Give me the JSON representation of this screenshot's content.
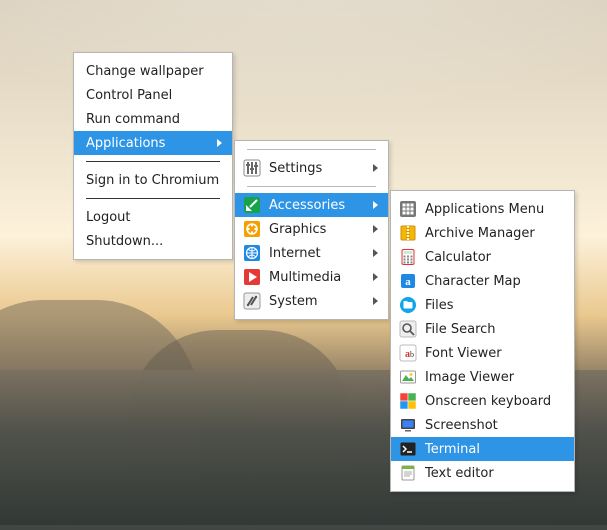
{
  "menu1": {
    "change_wallpaper": "Change wallpaper",
    "control_panel": "Control Panel",
    "run_command": "Run command",
    "applications": "Applications",
    "sign_in_chromium": "Sign in to Chromium",
    "logout": "Logout",
    "shutdown": "Shutdown..."
  },
  "menu2": {
    "settings": "Settings",
    "accessories": "Accessories",
    "graphics": "Graphics",
    "internet": "Internet",
    "multimedia": "Multimedia",
    "system": "System"
  },
  "menu3": {
    "applications_menu": "Applications Menu",
    "archive_manager": "Archive Manager",
    "calculator": "Calculator",
    "character_map": "Character Map",
    "files": "Files",
    "file_search": "File Search",
    "font_viewer": "Font Viewer",
    "image_viewer": "Image Viewer",
    "onscreen_keyboard": "Onscreen keyboard",
    "screenshot": "Screenshot",
    "terminal": "Terminal",
    "text_editor": "Text editor"
  },
  "colors": {
    "highlight": "#2e94e6"
  }
}
